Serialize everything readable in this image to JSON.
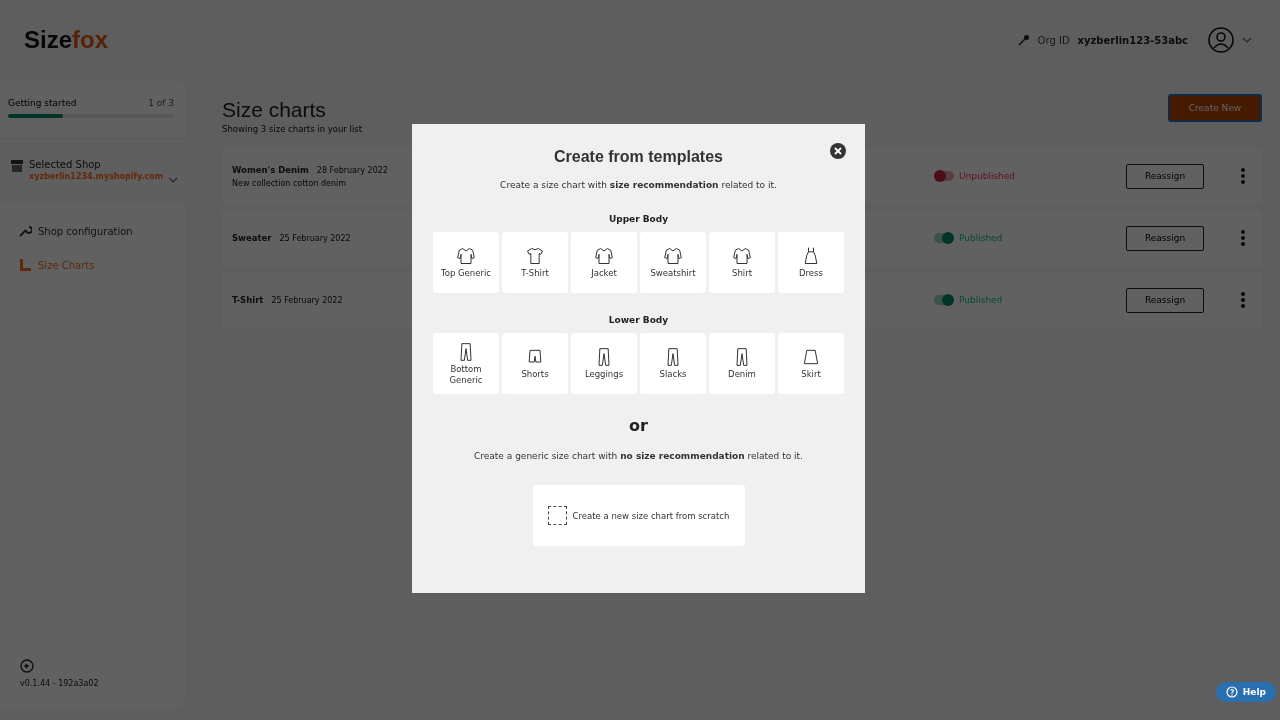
{
  "header": {
    "logo_dark": "Size",
    "logo_accent": "fox",
    "org_label": "Org ID",
    "org_id": "xyzberlin123-53abc"
  },
  "sidebar": {
    "getting_started": {
      "label": "Getting started",
      "count": "1 of 3",
      "level": 0.33
    },
    "shop": {
      "label": "Selected Shop",
      "value": "xyzberlin1234.myshopify.com"
    },
    "nav": [
      {
        "label": "Shop configuration",
        "selected": false
      },
      {
        "label": "Size Charts",
        "selected": true
      }
    ],
    "version": "v0.1.44 - 192a3a02"
  },
  "main": {
    "title": "Size charts",
    "subtitle": "Showing 3 size charts in your list",
    "create_button": "Create New",
    "rows": [
      {
        "name": "Women's Denim",
        "date": "28 February 2022",
        "description": "New collection cotton denim",
        "on": false,
        "status": "Unpublished",
        "action": "Reassign"
      },
      {
        "name": "Sweater",
        "date": "25 February 2022",
        "on": true,
        "status": "Published",
        "action": "Reassign"
      },
      {
        "name": "T-Shirt",
        "date": "25 February 2022",
        "on": true,
        "status": "Published",
        "action": "Reassign"
      }
    ]
  },
  "modal": {
    "title": "Create from templates",
    "intro": "Create a size chart with **size recommendation** related to it.",
    "groups": [
      {
        "title": "Upper Body",
        "items": [
          {
            "label": "Top Generic",
            "kind": "top"
          },
          {
            "label": "T-Shirt",
            "kind": "tee"
          },
          {
            "label": "Jacket",
            "kind": "top"
          },
          {
            "label": "Sweatshirt",
            "kind": "top"
          },
          {
            "label": "Shirt",
            "kind": "top"
          },
          {
            "label": "Dress",
            "kind": "dress"
          }
        ]
      },
      {
        "title": "Lower Body",
        "items": [
          {
            "label": "Bottom Generic",
            "kind": "pants"
          },
          {
            "label": "Shorts",
            "kind": "shorts"
          },
          {
            "label": "Leggings",
            "kind": "pants"
          },
          {
            "label": "Slacks",
            "kind": "pants"
          },
          {
            "label": "Denim",
            "kind": "pants"
          },
          {
            "label": "Skirt",
            "kind": "skirt"
          }
        ]
      }
    ],
    "or": "or",
    "generic_text": "Create a generic size chart with **no size recommendation** related to it.",
    "scratch_button": "Create a new size chart from scratch"
  },
  "help": "Help"
}
